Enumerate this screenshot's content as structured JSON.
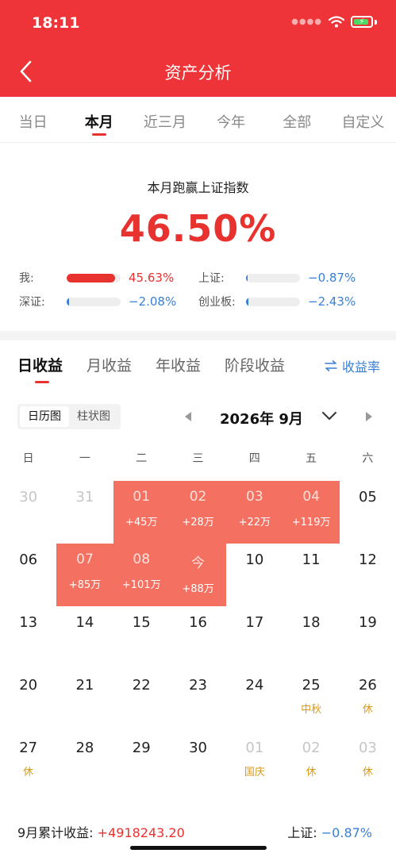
{
  "status_bar": {
    "time": "18:11"
  },
  "header": {
    "title": "资产分析"
  },
  "period_tabs": [
    {
      "label": "当日",
      "active": false
    },
    {
      "label": "本月",
      "active": true
    },
    {
      "label": "近三月",
      "active": false
    },
    {
      "label": "今年",
      "active": false
    },
    {
      "label": "全部",
      "active": false
    },
    {
      "label": "自定义",
      "active": false
    }
  ],
  "summary": {
    "title": "本月跑赢上证指数",
    "value": "46.50%",
    "comparisons": [
      {
        "label": "我:",
        "value": "45.63%",
        "fill": 0.9,
        "color": "#e8322f"
      },
      {
        "label": "上证:",
        "value": "−0.87%",
        "fill": 0.02,
        "color": "#3a7fd6"
      },
      {
        "label": "深证:",
        "value": "−2.08%",
        "fill": 0.04,
        "color": "#3a7fd6"
      },
      {
        "label": "创业板:",
        "value": "−2.43%",
        "fill": 0.05,
        "color": "#3a7fd6"
      }
    ]
  },
  "earnings_tabs": [
    {
      "label": "日收益",
      "active": true
    },
    {
      "label": "月收益",
      "active": false
    },
    {
      "label": "年收益",
      "active": false
    },
    {
      "label": "阶段收益",
      "active": false
    }
  ],
  "rate_toggle": {
    "label": "收益率"
  },
  "view_toggle": {
    "calendar": "日历图",
    "bar": "柱状图"
  },
  "month_nav": {
    "label": "2026年 9月"
  },
  "calendar": {
    "weekdays": [
      "日",
      "一",
      "二",
      "三",
      "四",
      "五",
      "六"
    ],
    "days": [
      {
        "day": "30",
        "other": true
      },
      {
        "day": "31",
        "other": true
      },
      {
        "day": "01",
        "amount": "+45万"
      },
      {
        "day": "02",
        "amount": "+28万"
      },
      {
        "day": "03",
        "amount": "+22万"
      },
      {
        "day": "04",
        "amount": "+119万"
      },
      {
        "day": "05"
      },
      {
        "day": "06"
      },
      {
        "day": "07",
        "amount": "+85万"
      },
      {
        "day": "08",
        "amount": "+101万"
      },
      {
        "day": "今",
        "amount": "+88万"
      },
      {
        "day": "10"
      },
      {
        "day": "11"
      },
      {
        "day": "12"
      },
      {
        "day": "13"
      },
      {
        "day": "14"
      },
      {
        "day": "15"
      },
      {
        "day": "16"
      },
      {
        "day": "17"
      },
      {
        "day": "18"
      },
      {
        "day": "19"
      },
      {
        "day": "20"
      },
      {
        "day": "21"
      },
      {
        "day": "22"
      },
      {
        "day": "23"
      },
      {
        "day": "24"
      },
      {
        "day": "25",
        "note": "中秋"
      },
      {
        "day": "26",
        "note": "休"
      },
      {
        "day": "27",
        "note": "休"
      },
      {
        "day": "28"
      },
      {
        "day": "29"
      },
      {
        "day": "30"
      },
      {
        "day": "01",
        "other": true,
        "note": "国庆"
      },
      {
        "day": "02",
        "other": true,
        "note": "休"
      },
      {
        "day": "03",
        "other": true,
        "note": "休"
      }
    ]
  },
  "footer": {
    "month_label": "9月累计收益:",
    "month_value": "+4918243.20",
    "index_label": "上证:",
    "index_value": "−0.87%"
  },
  "colors": {
    "brand": "#ee3438",
    "up": "#f47162",
    "down": "#3a7fd6",
    "holiday": "#d99a1a"
  }
}
